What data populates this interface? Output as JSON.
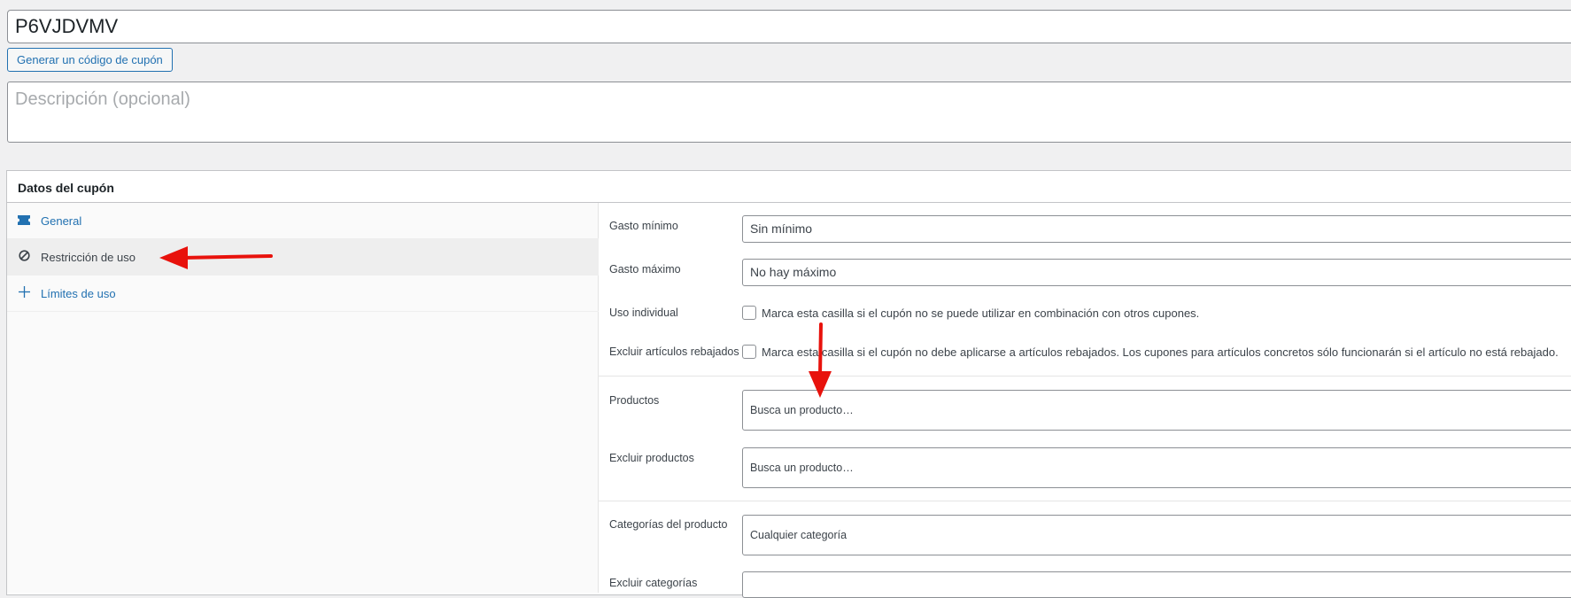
{
  "coupon": {
    "code": "P6VJDVMV",
    "generate_label": "Generar un código de cupón",
    "description_placeholder": "Descripción (opcional)"
  },
  "panel": {
    "title": "Datos del cupón",
    "tabs": [
      {
        "label": "General",
        "icon": "ticket-icon"
      },
      {
        "label": "Restricción de uso",
        "icon": "block-icon"
      },
      {
        "label": "Límites de uso",
        "icon": "crosshair-icon"
      }
    ]
  },
  "restrictions": {
    "min_spend_label": "Gasto mínimo",
    "min_spend_value": "Sin mínimo",
    "max_spend_label": "Gasto máximo",
    "max_spend_value": "No hay máximo",
    "individual_label": "Uso individual",
    "individual_text": "Marca esta casilla si el cupón no se puede utilizar en combinación con otros cupones.",
    "exclude_sale_label": "Excluir artículos rebajados",
    "exclude_sale_text": "Marca esta casilla si el cupón no debe aplicarse a artículos rebajados. Los cupones para artículos concretos sólo funcionarán si el artículo no está rebajado.",
    "products_label": "Productos",
    "products_placeholder": "Busca un producto…",
    "exclude_products_label": "Excluir productos",
    "exclude_products_placeholder": "Busca un producto…",
    "categories_label": "Categorías del producto",
    "categories_placeholder": "Cualquier categoría",
    "exclude_categories_label": "Excluir categorías"
  },
  "colors": {
    "accent": "#2271b1",
    "arrow": "#e8120c"
  }
}
